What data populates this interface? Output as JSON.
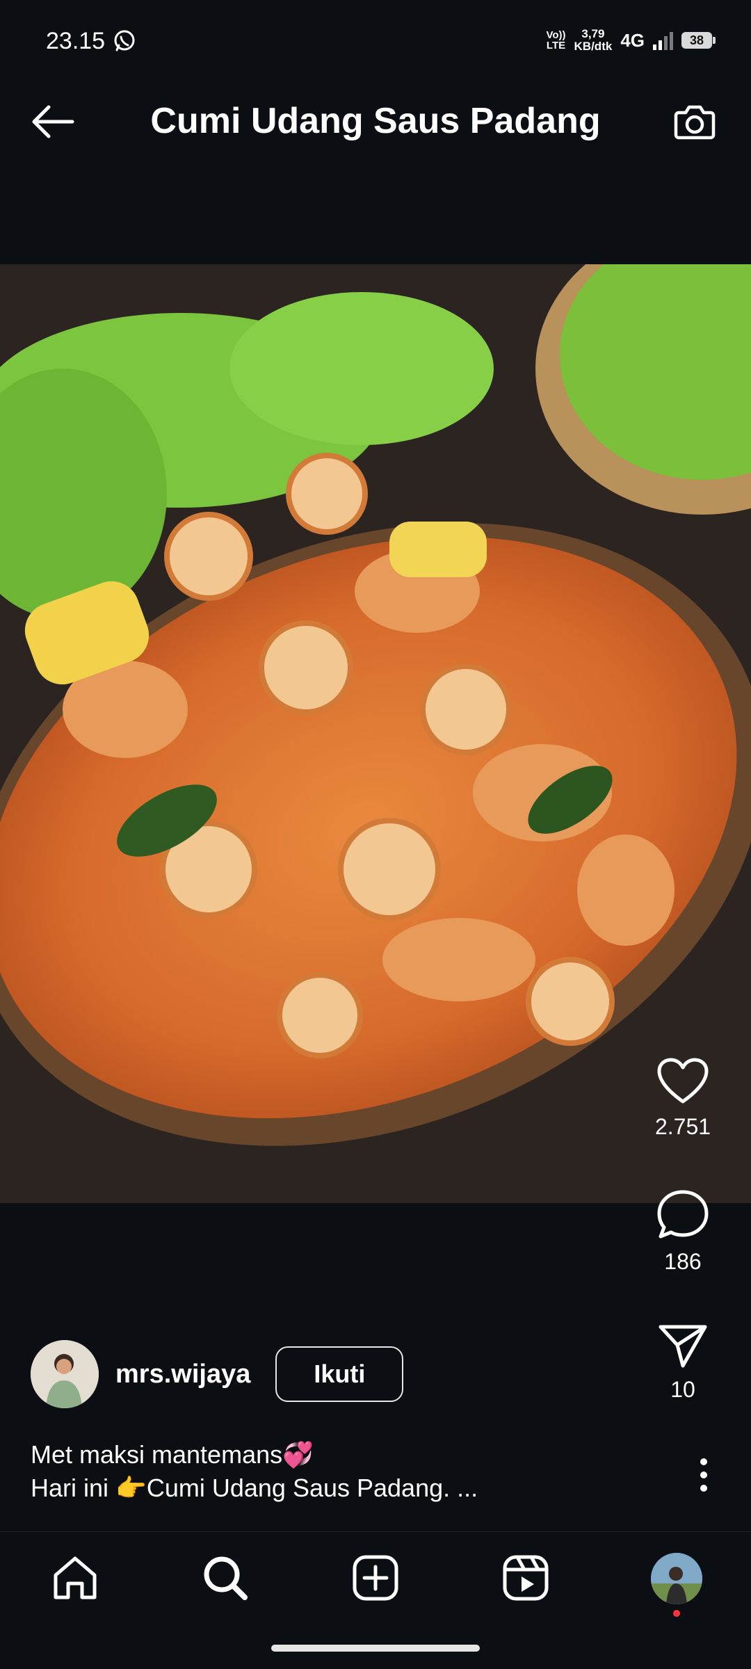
{
  "status_bar": {
    "time": "23.15",
    "volte_line1": "Vo))",
    "volte_line2": "LTE",
    "speed_value": "3,79",
    "speed_unit": "KB/dtk",
    "network": "4G",
    "battery": "38"
  },
  "header": {
    "title": "Cumi Udang Saus Padang"
  },
  "post": {
    "likes": "2.751",
    "comments": "186",
    "shares": "10",
    "username": "mrs.wijaya",
    "follow_label": "Ikuti",
    "caption_line1": "Met maksi mantemans💞",
    "caption_line2": "Hari ini 👉Cumi Udang Saus Padang. ..."
  },
  "colors": {
    "background": "#0b0f14",
    "text": "#ffffff",
    "notification_dot": "#ff3040"
  },
  "icons": [
    "back-arrow-icon",
    "camera-icon",
    "heart-icon",
    "comment-icon",
    "share-icon",
    "more-icon",
    "home-icon",
    "search-icon",
    "add-post-icon",
    "reels-icon",
    "whatsapp-icon"
  ]
}
